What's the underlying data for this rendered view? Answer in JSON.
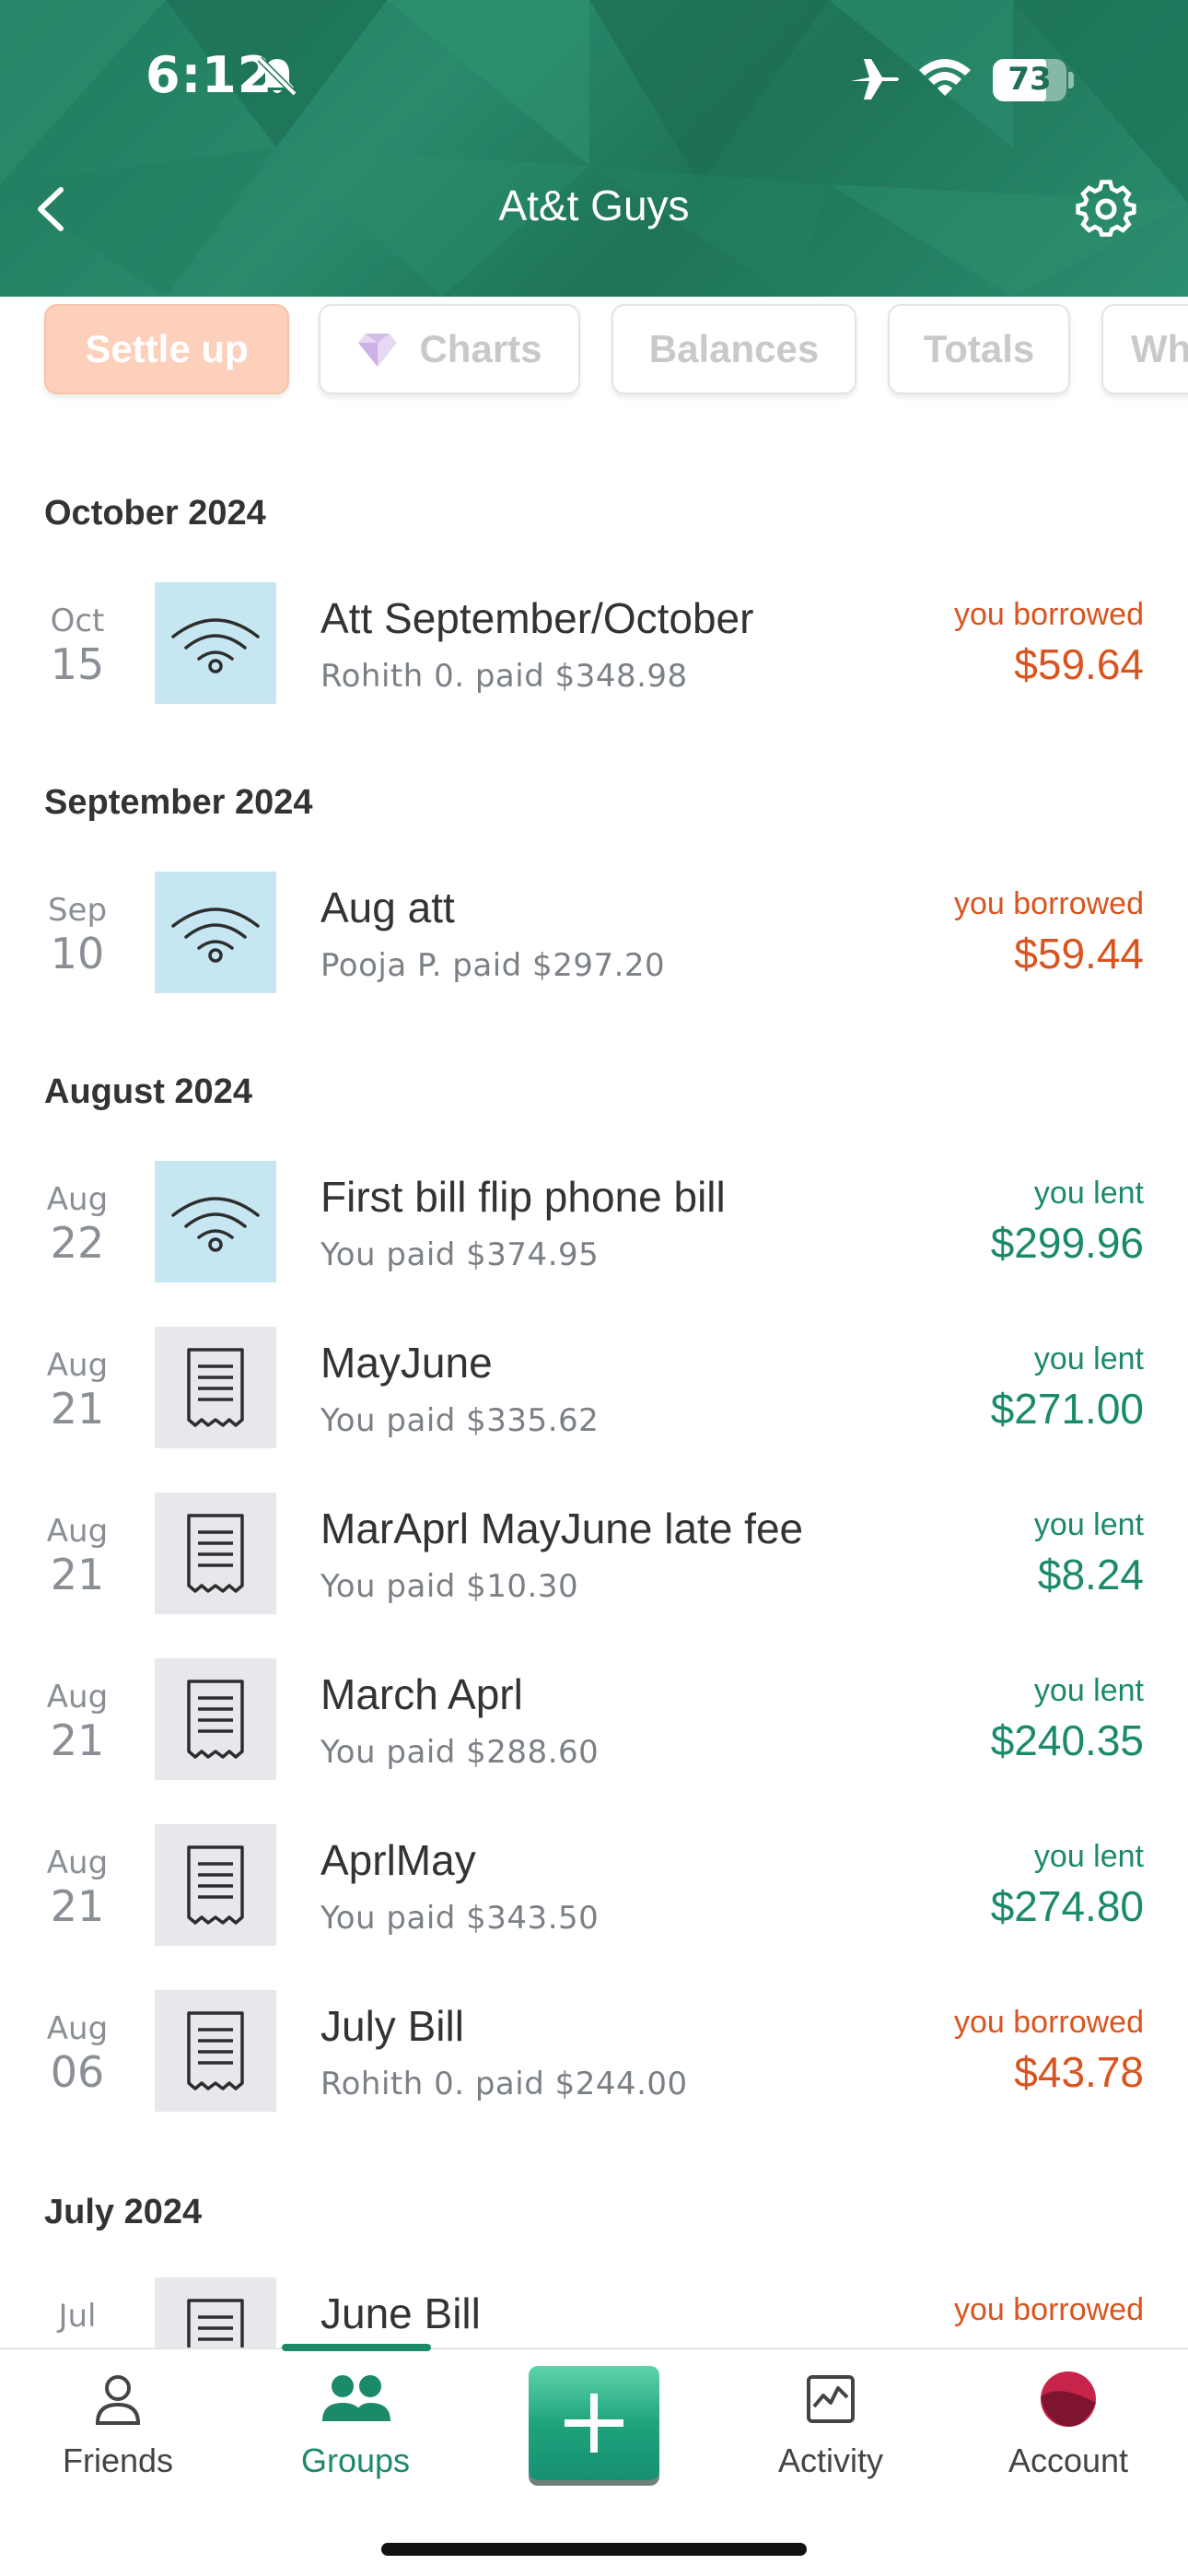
{
  "status_bar": {
    "time": "6:12",
    "battery": "73"
  },
  "header": {
    "title": "At&t Guys",
    "back_icon": "chevron-left-icon",
    "settings_icon": "gear-icon",
    "color": "#1f7a5e"
  },
  "tabs": [
    {
      "label": "Settle up",
      "name": "settle-up"
    },
    {
      "label": "Charts",
      "name": "charts",
      "icon": "gem-icon"
    },
    {
      "label": "Balances",
      "name": "balances"
    },
    {
      "label": "Totals",
      "name": "totals"
    },
    {
      "label": "Wh",
      "name": "more"
    }
  ],
  "sections": [
    {
      "title": "October 2024",
      "items": [
        {
          "month": "Oct",
          "day": "15",
          "icon": "wifi-icon",
          "description": "Att September/October",
          "paid": "Rohith 0. paid $348.98",
          "status": "you borrowed",
          "amount": "$59.64",
          "type": "borrowed"
        }
      ]
    },
    {
      "title": "September 2024",
      "items": [
        {
          "month": "Sep",
          "day": "10",
          "icon": "wifi-icon",
          "description": "Aug att",
          "paid": "Pooja P. paid $297.20",
          "status": "you borrowed",
          "amount": "$59.44",
          "type": "borrowed"
        }
      ]
    },
    {
      "title": "August 2024",
      "items": [
        {
          "month": "Aug",
          "day": "22",
          "icon": "wifi-icon",
          "description": "First bill flip phone bill",
          "paid": "You paid $374.95",
          "status": "you lent",
          "amount": "$299.96",
          "type": "lent"
        },
        {
          "month": "Aug",
          "day": "21",
          "icon": "receipt-icon",
          "description": "MayJune",
          "paid": "You paid $335.62",
          "status": "you lent",
          "amount": "$271.00",
          "type": "lent"
        },
        {
          "month": "Aug",
          "day": "21",
          "icon": "receipt-icon",
          "description": "MarAprl MayJune late fee",
          "paid": "You paid $10.30",
          "status": "you lent",
          "amount": "$8.24",
          "type": "lent"
        },
        {
          "month": "Aug",
          "day": "21",
          "icon": "receipt-icon",
          "description": "March Aprl",
          "paid": "You paid $288.60",
          "status": "you lent",
          "amount": "$240.35",
          "type": "lent"
        },
        {
          "month": "Aug",
          "day": "21",
          "icon": "receipt-icon",
          "description": "AprlMay",
          "paid": "You paid $343.50",
          "status": "you lent",
          "amount": "$274.80",
          "type": "lent"
        },
        {
          "month": "Aug",
          "day": "06",
          "icon": "receipt-icon",
          "description": "July Bill",
          "paid": "Rohith 0. paid $244.00",
          "status": "you borrowed",
          "amount": "$43.78",
          "type": "borrowed"
        }
      ]
    },
    {
      "title": "July 2024",
      "items": [
        {
          "month": "Jul",
          "day": "",
          "icon": "receipt-icon",
          "description": "June Bill",
          "paid": "",
          "status": "you borrowed",
          "amount": "",
          "type": "borrowed"
        }
      ]
    }
  ],
  "bottom_nav": [
    {
      "label": "Friends",
      "icon": "person-icon",
      "active": false
    },
    {
      "label": "Groups",
      "icon": "group-icon",
      "active": true
    },
    {
      "label": "",
      "icon": "plus-icon",
      "active": false
    },
    {
      "label": "Activity",
      "icon": "activity-icon",
      "active": false
    },
    {
      "label": "Account",
      "icon": "account-avatar-icon",
      "active": false
    }
  ],
  "colors": {
    "borrowed": "#d9541e",
    "lent": "#1b8a6b",
    "settle_up": "#fcd0bb"
  }
}
